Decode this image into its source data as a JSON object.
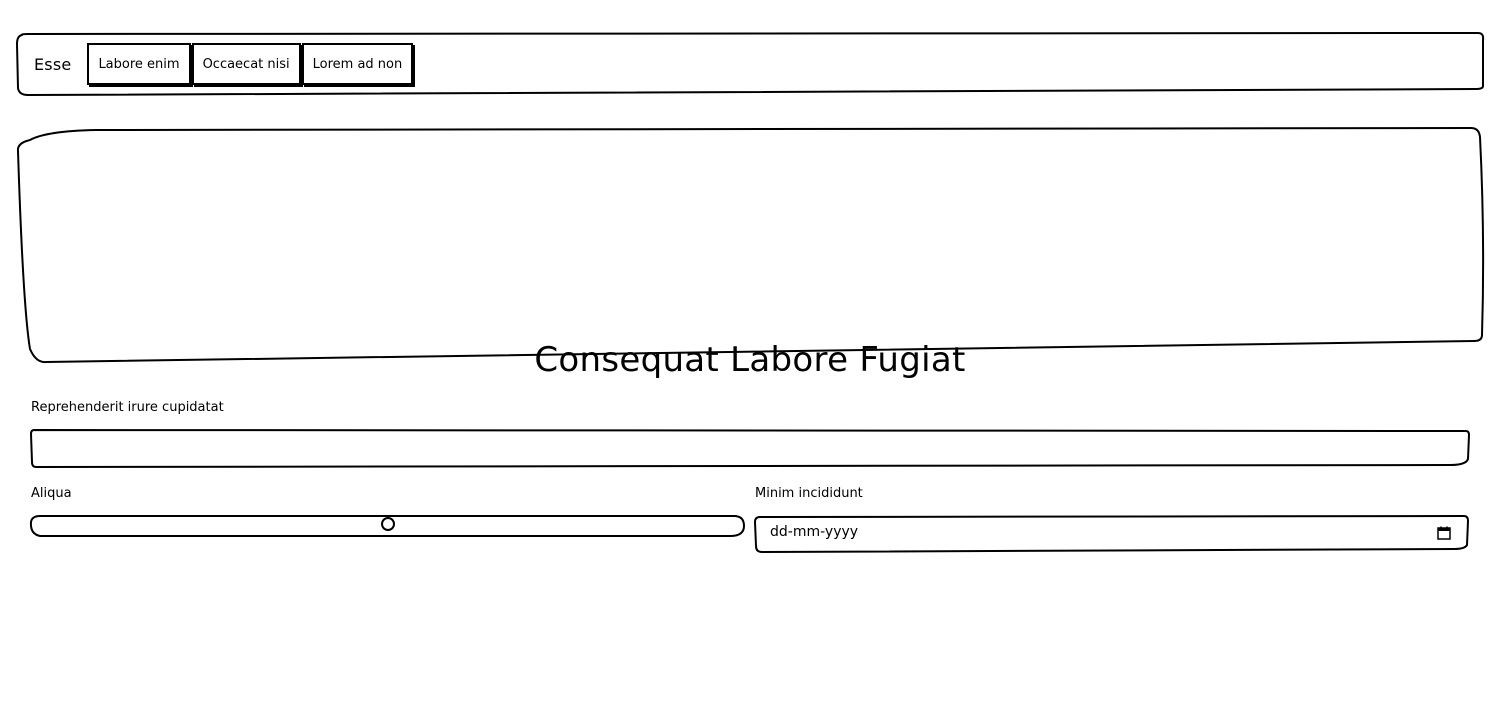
{
  "nav": {
    "brand": "Esse",
    "items": [
      "Labore enim",
      "Occaecat nisi",
      "Lorem ad non"
    ]
  },
  "hero": {
    "title": "Consequat Labore Fugiat"
  },
  "form": {
    "text_field": {
      "label": "Reprehenderit irure cupidatat",
      "value": ""
    },
    "range": {
      "label": "Aliqua",
      "value_fraction": 0.5
    },
    "date": {
      "label": "Minim incididunt",
      "placeholder": "dd-mm-yyyy",
      "icon": "calendar-icon"
    }
  }
}
